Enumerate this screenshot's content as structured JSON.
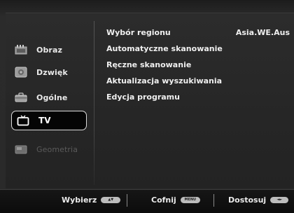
{
  "sidebar": {
    "items": [
      {
        "label": "Obraz",
        "icon": "picture-icon"
      },
      {
        "label": "Dzwięk",
        "icon": "sound-icon"
      },
      {
        "label": "Ogólne",
        "icon": "general-icon"
      },
      {
        "label": "TV",
        "icon": "tv-icon",
        "selected": true
      },
      {
        "label": "Geometria",
        "icon": "geometry-icon",
        "disabled": true
      }
    ]
  },
  "menu": {
    "items": [
      {
        "label": "Wybór regionu",
        "value": "Asia.WE.Aus"
      },
      {
        "label": "Automatyczne skanowanie"
      },
      {
        "label": "Ręczne skanowanie"
      },
      {
        "label": "Aktualizacja wyszukiwania"
      },
      {
        "label": "Edycja programu"
      }
    ]
  },
  "footer": {
    "hints": [
      {
        "label": "Wybierz",
        "key": "▲▼"
      },
      {
        "label": "Cofnij",
        "key": "MENU"
      },
      {
        "label": "Dostosuj",
        "key": "◄►"
      }
    ]
  }
}
